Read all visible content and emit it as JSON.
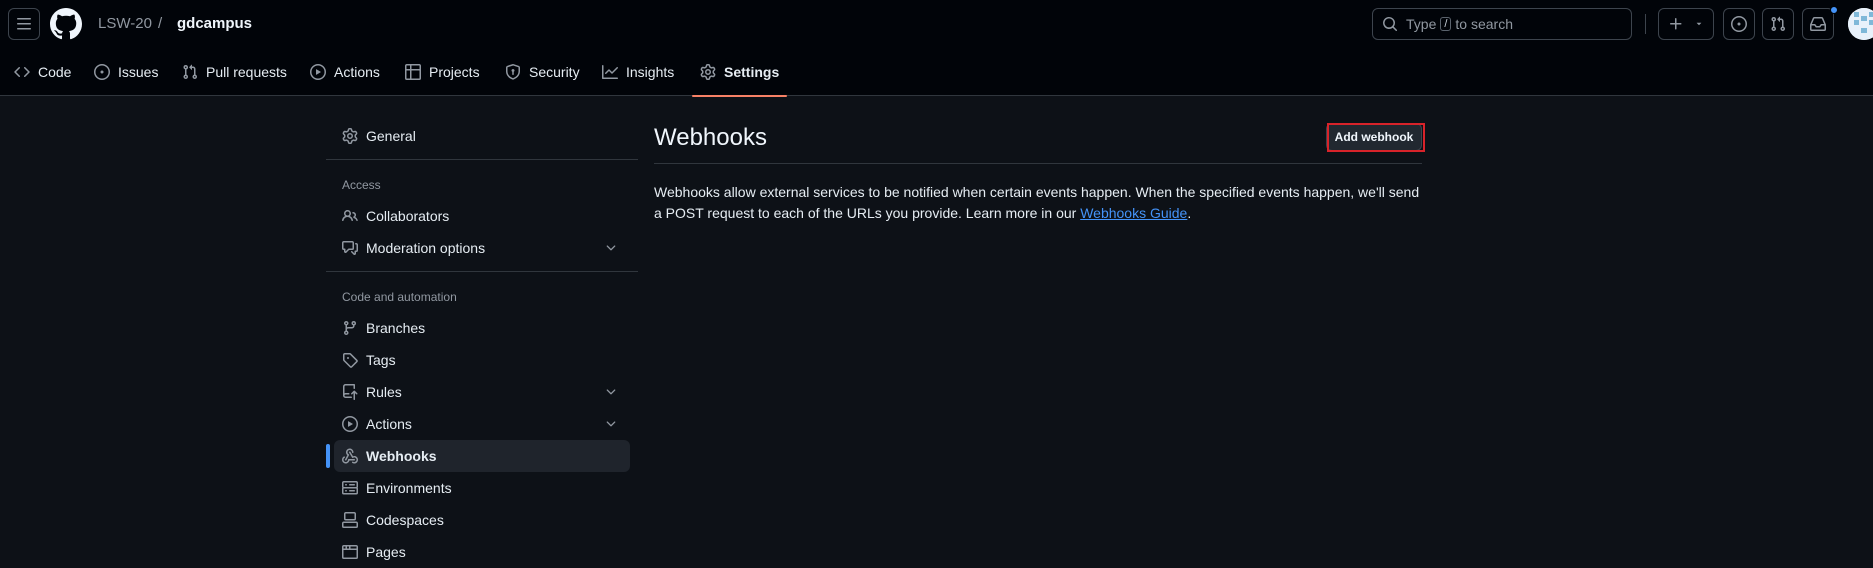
{
  "header": {
    "owner": "LSW-20",
    "separator": "/",
    "repo": "gdcampus",
    "search_prefix": "Type",
    "search_key": "/",
    "search_suffix": "to search"
  },
  "tabs": [
    {
      "label": "Code",
      "icon": "code-icon"
    },
    {
      "label": "Issues",
      "icon": "issue-opened-icon"
    },
    {
      "label": "Pull requests",
      "icon": "git-pull-request-icon"
    },
    {
      "label": "Actions",
      "icon": "play-icon"
    },
    {
      "label": "Projects",
      "icon": "table-icon"
    },
    {
      "label": "Security",
      "icon": "shield-icon"
    },
    {
      "label": "Insights",
      "icon": "graph-icon"
    },
    {
      "label": "Settings",
      "icon": "gear-icon",
      "active": true
    }
  ],
  "sidebar": {
    "general": "General",
    "access_heading": "Access",
    "collaborators": "Collaborators",
    "moderation": "Moderation options",
    "code_heading": "Code and automation",
    "branches": "Branches",
    "tags": "Tags",
    "rules": "Rules",
    "actions": "Actions",
    "webhooks": "Webhooks",
    "environments": "Environments",
    "codespaces": "Codespaces",
    "pages": "Pages"
  },
  "main": {
    "title": "Webhooks",
    "add_button": "Add webhook",
    "description_start": "Webhooks allow external services to be notified when certain events happen. When the specified events happen, we'll send a POST request to each of the URLs you provide. Learn more in our ",
    "link_text": "Webhooks Guide",
    "description_end": "."
  },
  "colors": {
    "accent_blue": "#4493f8",
    "tab_underline": "#f78166",
    "highlight_red": "#d8232a",
    "notification_dot": "#4493f8"
  }
}
